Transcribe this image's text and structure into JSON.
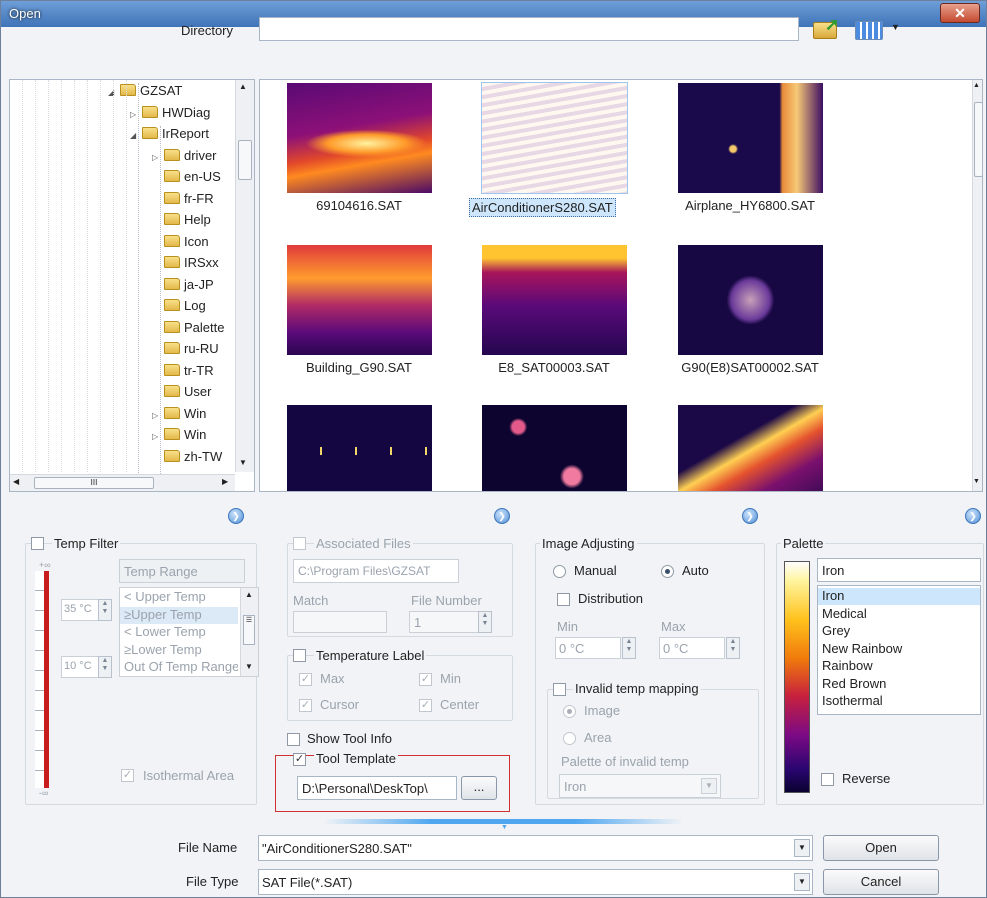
{
  "window": {
    "title": "Open"
  },
  "directory": {
    "label": "Directory",
    "value": ""
  },
  "tree": {
    "items": [
      {
        "label": "GZSAT",
        "level": 0,
        "expand": "◢"
      },
      {
        "label": "HWDiag",
        "level": 1,
        "expand": "▷"
      },
      {
        "label": "IrReport",
        "level": 1,
        "expand": "◢"
      },
      {
        "label": "driver",
        "level": 2,
        "expand": "▷"
      },
      {
        "label": "en-US",
        "level": 2,
        "expand": ""
      },
      {
        "label": "fr-FR",
        "level": 2,
        "expand": ""
      },
      {
        "label": "Help",
        "level": 2,
        "expand": ""
      },
      {
        "label": "Icon",
        "level": 2,
        "expand": ""
      },
      {
        "label": "IRSxx",
        "level": 2,
        "expand": ""
      },
      {
        "label": "ja-JP",
        "level": 2,
        "expand": ""
      },
      {
        "label": "Log",
        "level": 2,
        "expand": ""
      },
      {
        "label": "Palette",
        "level": 2,
        "expand": ""
      },
      {
        "label": "ru-RU",
        "level": 2,
        "expand": ""
      },
      {
        "label": "tr-TR",
        "level": 2,
        "expand": ""
      },
      {
        "label": "User",
        "level": 2,
        "expand": ""
      },
      {
        "label": "Win",
        "level": 2,
        "expand": "▷"
      },
      {
        "label": "Win",
        "level": 2,
        "expand": "▷"
      },
      {
        "label": "zh-TW",
        "level": 2,
        "expand": ""
      }
    ]
  },
  "files": [
    {
      "name": "69104616.SAT"
    },
    {
      "name": "AirConditionerS280.SAT",
      "selected": true
    },
    {
      "name": "Airplane_HY6800.SAT"
    },
    {
      "name": "Building_G90.SAT"
    },
    {
      "name": "E8_SAT00003.SAT"
    },
    {
      "name": "G90(E8)SAT00002.SAT"
    },
    {
      "name": ""
    },
    {
      "name": ""
    },
    {
      "name": ""
    }
  ],
  "temp_filter": {
    "label": "Temp Filter",
    "scale_top": "+∞",
    "scale_bottom": "-∞",
    "range_header": "Temp Range",
    "upper_value": "35 °C",
    "lower_value": "10 °C",
    "options": [
      "< Upper Temp",
      "≥Upper Temp",
      "< Lower Temp",
      "≥Lower Temp",
      "Out Of Temp Range"
    ],
    "selected_index": 1,
    "isothermal": "Isothermal Area"
  },
  "associated": {
    "label": "Associated Files",
    "path": "C:\\Program Files\\GZSAT",
    "match_label": "Match",
    "file_number_label": "File Number",
    "file_number": "1",
    "temp_label": "Temperature Label",
    "max": "Max",
    "min": "Min",
    "cursor": "Cursor",
    "center": "Center",
    "show_tool_info": "Show Tool Info",
    "tool_template": "Tool Template",
    "template_path": "D:\\Personal\\DeskTop\\",
    "browse": "..."
  },
  "image_adjusting": {
    "label": "Image Adjusting",
    "manual": "Manual",
    "auto": "Auto",
    "distribution": "Distribution",
    "min_label": "Min",
    "max_label": "Max",
    "min_value": "0 °C",
    "max_value": "0 °C",
    "invalid": "Invalid temp mapping",
    "image": "Image",
    "area": "Area",
    "palette_invalid": "Palette of invalid temp",
    "palette_invalid_value": "Iron"
  },
  "palette": {
    "label": "Palette",
    "selected": "Iron",
    "options": [
      "Iron",
      "Medical",
      "Grey",
      "New Rainbow",
      "Rainbow",
      "Red Brown",
      "Isothermal"
    ],
    "reverse": "Reverse"
  },
  "footer": {
    "file_name_label": "File Name",
    "file_name_value": "\"AirConditionerS280.SAT\"",
    "file_type_label": "File Type",
    "file_type_value": "SAT File(*.SAT)",
    "open": "Open",
    "cancel": "Cancel"
  },
  "colors": {
    "accent": "#3f73b8",
    "selection": "#cde6fb",
    "highlight_border": "#d03030"
  }
}
